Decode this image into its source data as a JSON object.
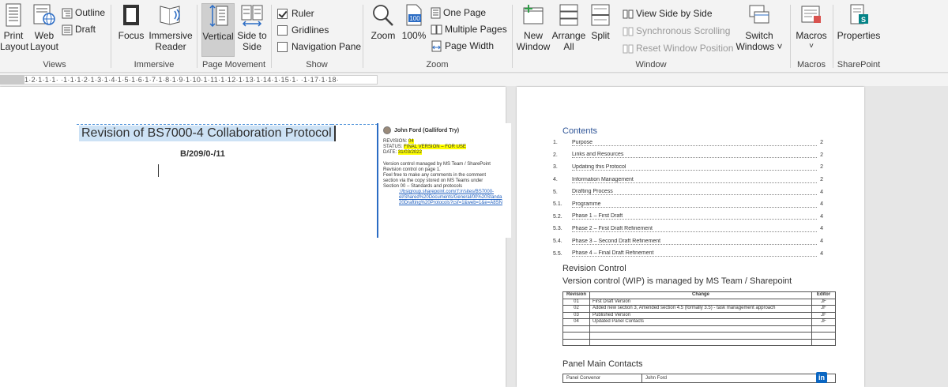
{
  "ribbon": {
    "views": {
      "label": "Views",
      "print_layout": "Print Layout",
      "web_layout": "Web Layout",
      "outline": "Outline",
      "draft": "Draft"
    },
    "immersive": {
      "label": "Immersive",
      "focus": "Focus",
      "immersive_reader": "Immersive Reader"
    },
    "page_movement": {
      "label": "Page Movement",
      "vertical": "Vertical",
      "side_to_side": "Side to Side"
    },
    "show": {
      "label": "Show",
      "ruler": "Ruler",
      "gridlines": "Gridlines",
      "navigation_pane": "Navigation Pane",
      "ruler_checked": true,
      "gridlines_checked": false,
      "navigation_checked": false
    },
    "zoom": {
      "label": "Zoom",
      "zoom": "Zoom",
      "hundred_percent": "100%",
      "hundred_icon_text": "100",
      "one_page": "One Page",
      "multiple_pages": "Multiple Pages",
      "page_width": "Page Width"
    },
    "window": {
      "label": "Window",
      "new_window": "New Window",
      "arrange_all": "Arrange All",
      "split": "Split",
      "view_side_by_side": "View Side by Side",
      "synchronous_scrolling": "Synchronous Scrolling",
      "reset_window_position": "Reset Window Position",
      "switch_windows": "Switch Windows"
    },
    "macros": {
      "label": "Macros",
      "macros": "Macros"
    },
    "sharepoint": {
      "label": "SharePoint",
      "properties": "Properties"
    }
  },
  "ruler": {
    "ticks": "1·2·1·1·1·  ·1·1·1·2·1·3·1·4·1·5·1·6·1·7·1·8·1·9·1·10·1·11·1·12·1·13·1·14·1·15·1·  ·1·17·1·18·"
  },
  "page1": {
    "title": "Revision of BS7000-4 Collaboration Protocol",
    "code": "B/209/0-/11"
  },
  "comment": {
    "author": "John Ford (Galliford Try)",
    "revision_label": "REVISION:",
    "revision_value": "04",
    "status_label": "STATUS:",
    "status_value": "FINAL VERSION – FOR USE",
    "date_label": "DATE:",
    "date_value": "31/03/2022",
    "body_lines": [
      "Version control managed by MS Team / SharePoint",
      "Revision control on page 1.",
      "Feel free to make any comments in the comment",
      "section via the copy stored on MS Teams under",
      "Section 00 – Standards and protocols"
    ],
    "link_lines": [
      "://bsigroup.sharepoint.com/:f:/r/sites/BS7000-",
      "el/Shared%20Documents/General/00%20Standa",
      "20Drafting%20Protocols?csf=1&web=1&e=A8SN"
    ]
  },
  "page2": {
    "contents_heading": "Contents",
    "toc": [
      {
        "num": "1.",
        "text": "Purpose",
        "page": "2"
      },
      {
        "num": "2.",
        "text": "Links and Resources",
        "page": "2"
      },
      {
        "num": "3.",
        "text": "Updating this Protocol",
        "page": "2"
      },
      {
        "num": "4.",
        "text": "Information Management",
        "page": "2"
      },
      {
        "num": "5.",
        "text": "Drafting Process",
        "page": "4"
      },
      {
        "num": "5.1.",
        "text": "Programme",
        "page": "4"
      },
      {
        "num": "5.2.",
        "text": "Phase 1 – First Draft",
        "page": "4"
      },
      {
        "num": "5.3.",
        "text": "Phase 2 – First Draft Refinement",
        "page": "4"
      },
      {
        "num": "5.4.",
        "text": "Phase 3 – Second Draft Refinement",
        "page": "4"
      },
      {
        "num": "5.5.",
        "text": "Phase 4 – Final Draft Refinement",
        "page": "4"
      }
    ],
    "revision_control_heading": "Revision Control",
    "version_control_text": "Version control (WIP) is managed by MS Team / Sharepoint",
    "rev_table": {
      "headers": [
        "Revision",
        "Change",
        "Editor"
      ],
      "rows": [
        [
          "01",
          "First Draft Version",
          "JF"
        ],
        [
          "02",
          "Added new section 3, Amended section 4.5 (formally 3.5) - task management approach",
          "JF"
        ],
        [
          "03",
          "Published Version",
          "JF"
        ],
        [
          "04",
          "Updated Panel Contacts",
          "JF"
        ],
        [
          "",
          "",
          ""
        ],
        [
          "",
          "",
          ""
        ],
        [
          "",
          "",
          ""
        ]
      ]
    },
    "panel_heading": "Panel Main Contacts",
    "contacts": [
      {
        "role": "Panel Convenor",
        "name": "John Ford"
      }
    ],
    "linkedin_text": "in"
  }
}
